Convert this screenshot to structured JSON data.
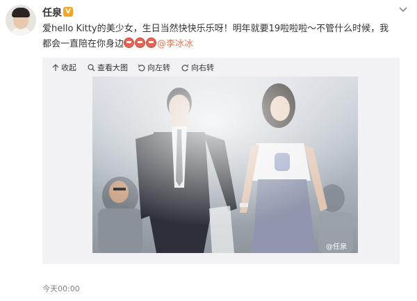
{
  "post": {
    "author": "任泉",
    "verified_badge": "V",
    "text_main": "爱hello Kitty的美少女，生日当然快快乐乐呀！明年就要19啦啦啦～不管什么时候，我都会一直陪在你身边",
    "mention": "@李冰冰",
    "timestamp": "今天00:00"
  },
  "toolbar": {
    "collapse": "收起",
    "view_large": "查看大图",
    "rotate_left": "向左转",
    "rotate_right": "向右转"
  },
  "photo": {
    "watermark": "@任泉"
  },
  "colors": {
    "accent": "#eb7350",
    "badge": "#f5a623",
    "media_bg": "#f2f2f5"
  }
}
